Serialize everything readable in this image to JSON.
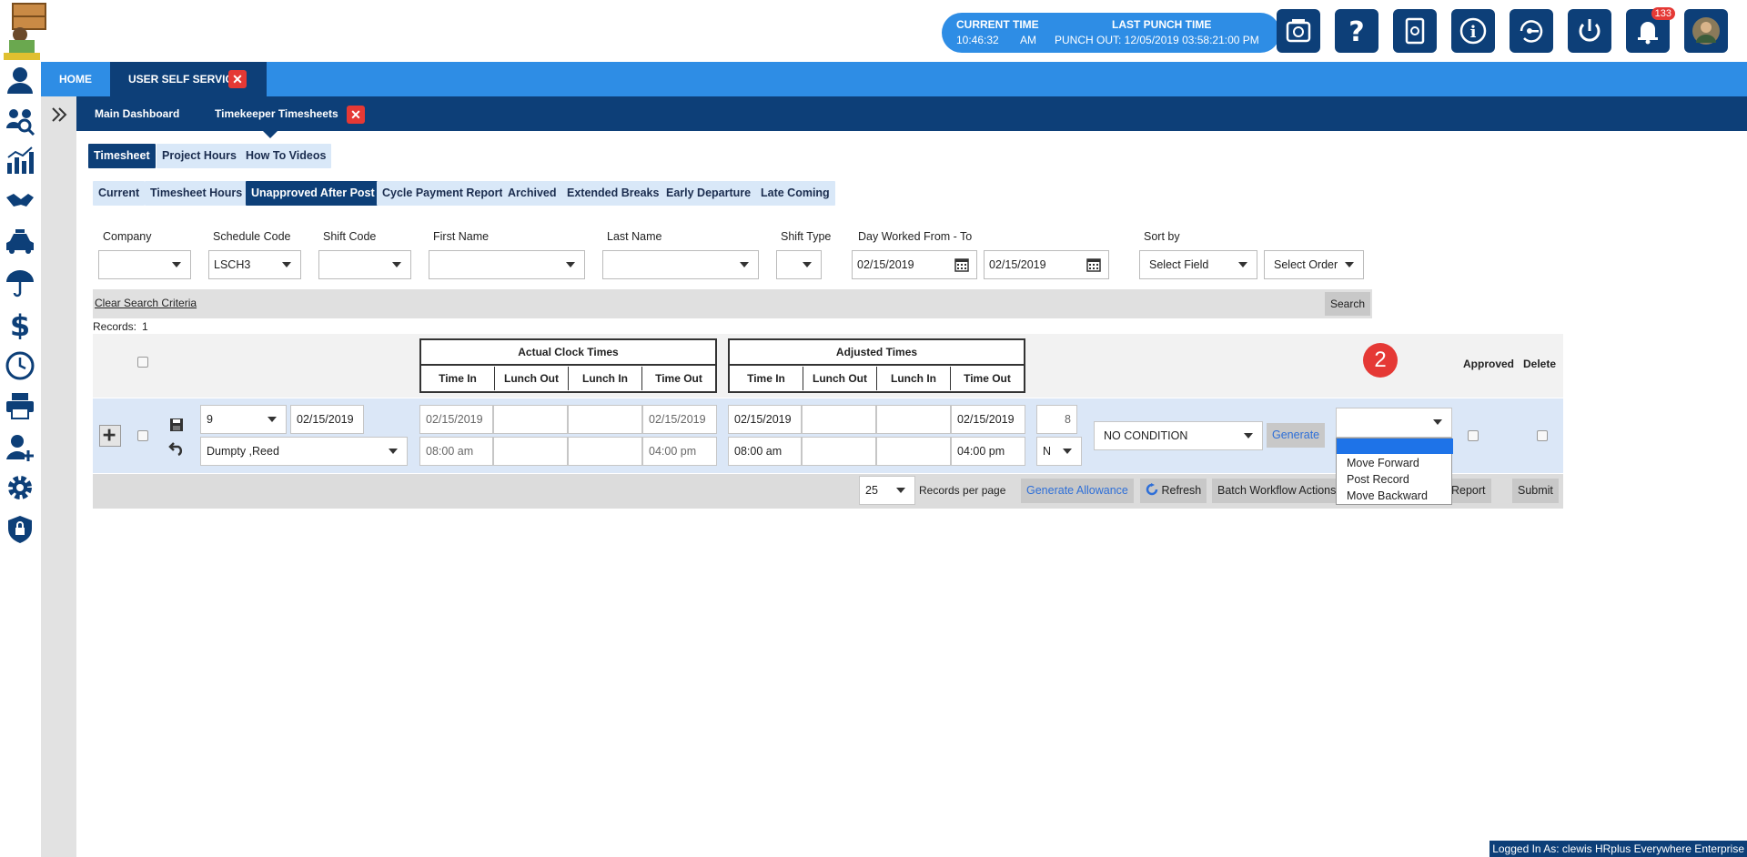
{
  "header": {
    "current_time_label": "CURRENT TIME",
    "current_time_value": "10:46:32",
    "current_time_ampm": "AM",
    "last_punch_label": "LAST PUNCH TIME",
    "last_punch_value": "PUNCH OUT: 12/05/2019 03:58:21:00 PM",
    "notification_count": "133",
    "icons": [
      "timeclock-icon",
      "help-icon",
      "settings-book-icon",
      "info-icon",
      "password-reset-icon",
      "power-icon",
      "bell-icon",
      "avatar"
    ]
  },
  "nav": {
    "home": "HOME",
    "user_self_service": "USER SELF SERVICE",
    "main_dashboard": "Main Dashboard",
    "timekeeper_timesheets": "Timekeeper Timesheets",
    "close_glyph": "✕"
  },
  "tabs": [
    "Timesheet",
    "Project Hours",
    "How To Videos"
  ],
  "subtabs": [
    "Current",
    "Timesheet Hours",
    "Unapproved After Post",
    "Cycle Payment Report",
    "Archived",
    "Extended Breaks",
    "Early Departure",
    "Late Coming"
  ],
  "filters": {
    "company_label": "Company",
    "schedule_code_label": "Schedule Code",
    "schedule_code_value": "LSCH3",
    "shift_code_label": "Shift Code",
    "first_name_label": "First Name",
    "last_name_label": "Last Name",
    "shift_type_label": "Shift Type",
    "day_worked_label": "Day Worked From - To",
    "day_from": "02/15/2019",
    "day_to": "02/15/2019",
    "sort_by_label": "Sort by",
    "sort_field": "Select Field",
    "sort_order": "Select Order"
  },
  "search": {
    "clear_label": "Clear Search Criteria",
    "search_button": "Search",
    "records_label": "Records:",
    "records_count": "1"
  },
  "table": {
    "actual_header": "Actual Clock Times",
    "adjusted_header": "Adjusted Times",
    "sub_headers": [
      "Time In",
      "Lunch Out",
      "Lunch In",
      "Time Out"
    ],
    "step_marker": "2",
    "approved_header": "Approved",
    "delete_header": "Delete",
    "row": {
      "number": "9",
      "date": "02/15/2019",
      "employee": "Dumpty ,Reed",
      "actual_date_in": "02/15/2019",
      "actual_date_out": "02/15/2019",
      "actual_time_in": "08:00 am",
      "actual_time_out": "04:00 pm",
      "adjusted_date_in": "02/15/2019",
      "adjusted_date_out": "02/15/2019",
      "adjusted_time_in": "08:00 am",
      "adjusted_time_out": "04:00 pm",
      "hours": "8",
      "flag": "N",
      "condition": "NO CONDITION",
      "generate_label": "Generate"
    },
    "workflow_options": [
      "Move Forward",
      "Post Record",
      "Move Backward"
    ]
  },
  "footer": {
    "per_page_value": "25",
    "per_page_label": "Records per page",
    "generate_allowance": "Generate Allowance",
    "refresh": "Refresh",
    "batch_workflow": "Batch Workflow Actions",
    "report": "Report",
    "submit": "Submit",
    "logged_in": "Logged In As: clewis HRplus Everywhere Enterprise"
  }
}
